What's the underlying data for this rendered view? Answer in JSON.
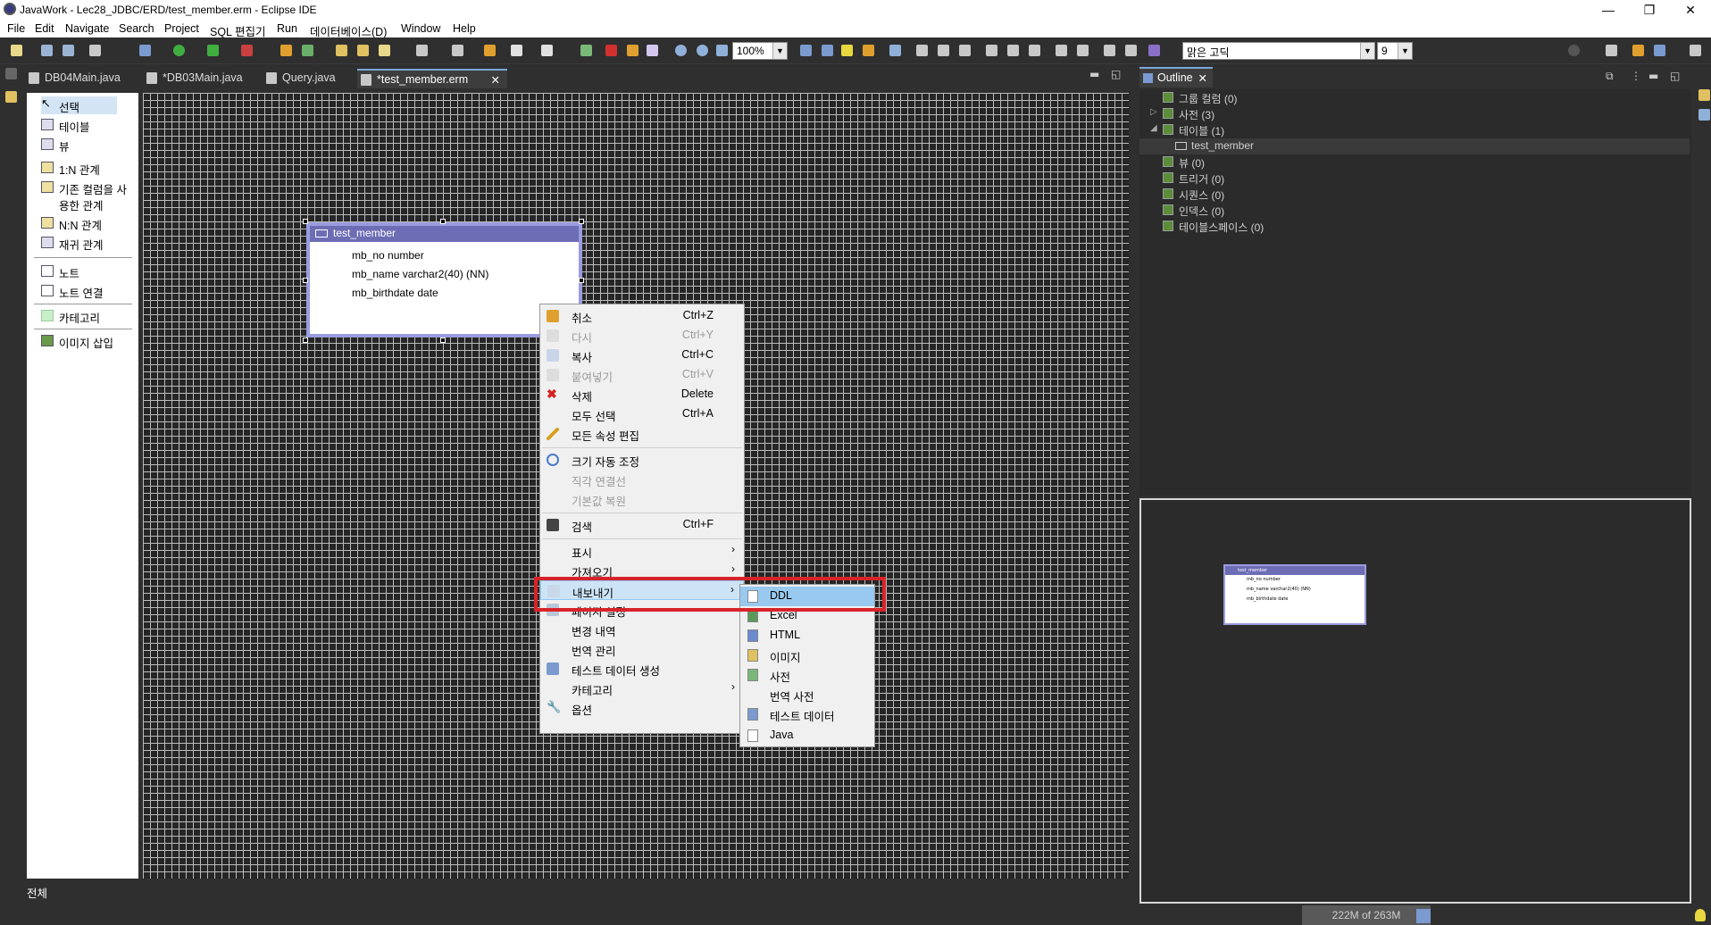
{
  "window": {
    "title": "JavaWork - Lec28_JDBC/ERD/test_member.erm - Eclipse IDE",
    "minimize": "—",
    "maximize": "❐",
    "close": "✕"
  },
  "menubar": [
    "File",
    "Edit",
    "Navigate",
    "Search",
    "Project",
    "SQL 편집기",
    "Run",
    "데이터베이스(D)",
    "Window",
    "Help"
  ],
  "toolbar": {
    "zoom": "100%",
    "font": "맑은 고딕",
    "font_size": "9"
  },
  "tabs": [
    {
      "label": "DB04Main.java"
    },
    {
      "label": "*DB03Main.java"
    },
    {
      "label": "Query.java"
    },
    {
      "label": "*test_member.erm",
      "active": true
    }
  ],
  "palette": [
    "선택",
    "테이블",
    "뷰",
    "1:N 관계",
    "기존 컬럼을 사",
    "용한 관계",
    "N:N 관계",
    "재귀 관계",
    "노트",
    "노트 연결",
    "카테고리",
    "이미지 삽입"
  ],
  "all_label": "전체",
  "erd_table": {
    "name": "test_member",
    "columns": [
      "mb_no number",
      "mb_name varchar2(40) (NN)",
      "mb_birthdate date"
    ]
  },
  "context_menu": [
    {
      "label": "취소",
      "shortcut": "Ctrl+Z"
    },
    {
      "label": "다시",
      "shortcut": "Ctrl+Y",
      "disabled": true
    },
    {
      "label": "복사",
      "shortcut": "Ctrl+C"
    },
    {
      "label": "붙여넣기",
      "shortcut": "Ctrl+V",
      "disabled": true
    },
    {
      "label": "삭제",
      "shortcut": "Delete"
    },
    {
      "label": "모두 선택",
      "shortcut": "Ctrl+A"
    },
    {
      "label": "모든 속성 편집",
      "shortcut": ""
    },
    {
      "label": "크기 자동 조정",
      "shortcut": ""
    },
    {
      "label": "직각 연결선",
      "shortcut": "",
      "disabled": true
    },
    {
      "label": "기본값 복원",
      "shortcut": "",
      "disabled": true
    },
    {
      "label": "검색",
      "shortcut": "Ctrl+F"
    },
    {
      "label": "표시",
      "shortcut": ""
    },
    {
      "label": "가져오기",
      "shortcut": ""
    },
    {
      "label": "내보내기",
      "shortcut": ""
    },
    {
      "label": "페이지 설정",
      "shortcut": ""
    },
    {
      "label": "변경 내역",
      "shortcut": ""
    },
    {
      "label": "번역 관리",
      "shortcut": ""
    },
    {
      "label": "테스트 데이터 생성",
      "shortcut": ""
    },
    {
      "label": "카테고리",
      "shortcut": ""
    },
    {
      "label": "옵션",
      "shortcut": ""
    }
  ],
  "submenu": [
    "DDL",
    "Excel",
    "HTML",
    "이미지",
    "사전",
    "번역 사전",
    "테스트 데이터",
    "Java"
  ],
  "outline": {
    "title": "Outline",
    "items": [
      "그룹 컬럼 (0)",
      "사전 (3)",
      "테이블 (1)",
      "test_member",
      "뷰 (0)",
      "트리거 (0)",
      "시퀀스 (0)",
      "인덱스 (0)",
      "테이블스페이스 (0)"
    ],
    "mini_columns": [
      "mb_no number",
      "mb_name varchar2(40) (NN)",
      "mb_birthdate date"
    ],
    "mini_title": "test_member"
  },
  "status": {
    "memory": "222M of 263M"
  },
  "colors": {
    "accent": "#d8232a",
    "table_header": "#6d6db5",
    "selection": "#99c9ef"
  }
}
